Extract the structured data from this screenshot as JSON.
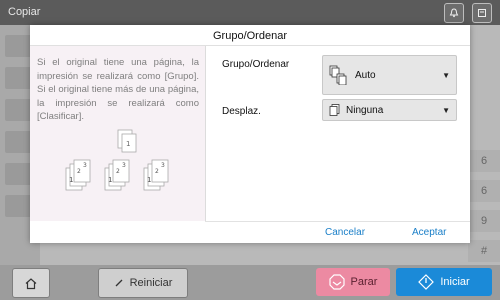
{
  "app": {
    "title": "Copiar"
  },
  "dialog": {
    "title": "Grupo/Ordenar",
    "help_text": "Si el original tiene una página, la impresión se realizará como [Grupo]. Si el original tiene más de una página, la impresión se realizará como [Clasificar].",
    "options": [
      {
        "label": "Grupo/Ordenar",
        "value": "Auto",
        "icon": "group-sort-icon"
      },
      {
        "label": "Desplaz.",
        "value": "Ninguna",
        "icon": "page-icon"
      }
    ],
    "cancel_label": "Cancelar",
    "accept_label": "Aceptar"
  },
  "background": {
    "numpad": [
      "6",
      "6",
      "9",
      "#"
    ]
  },
  "bottom": {
    "reset_label": "Reiniciar",
    "stop_label": "Parar",
    "start_label": "Iniciar"
  },
  "colors": {
    "accent": "#1a7fc8",
    "stop": "#ec8aa2",
    "start": "#1b8ad8"
  }
}
